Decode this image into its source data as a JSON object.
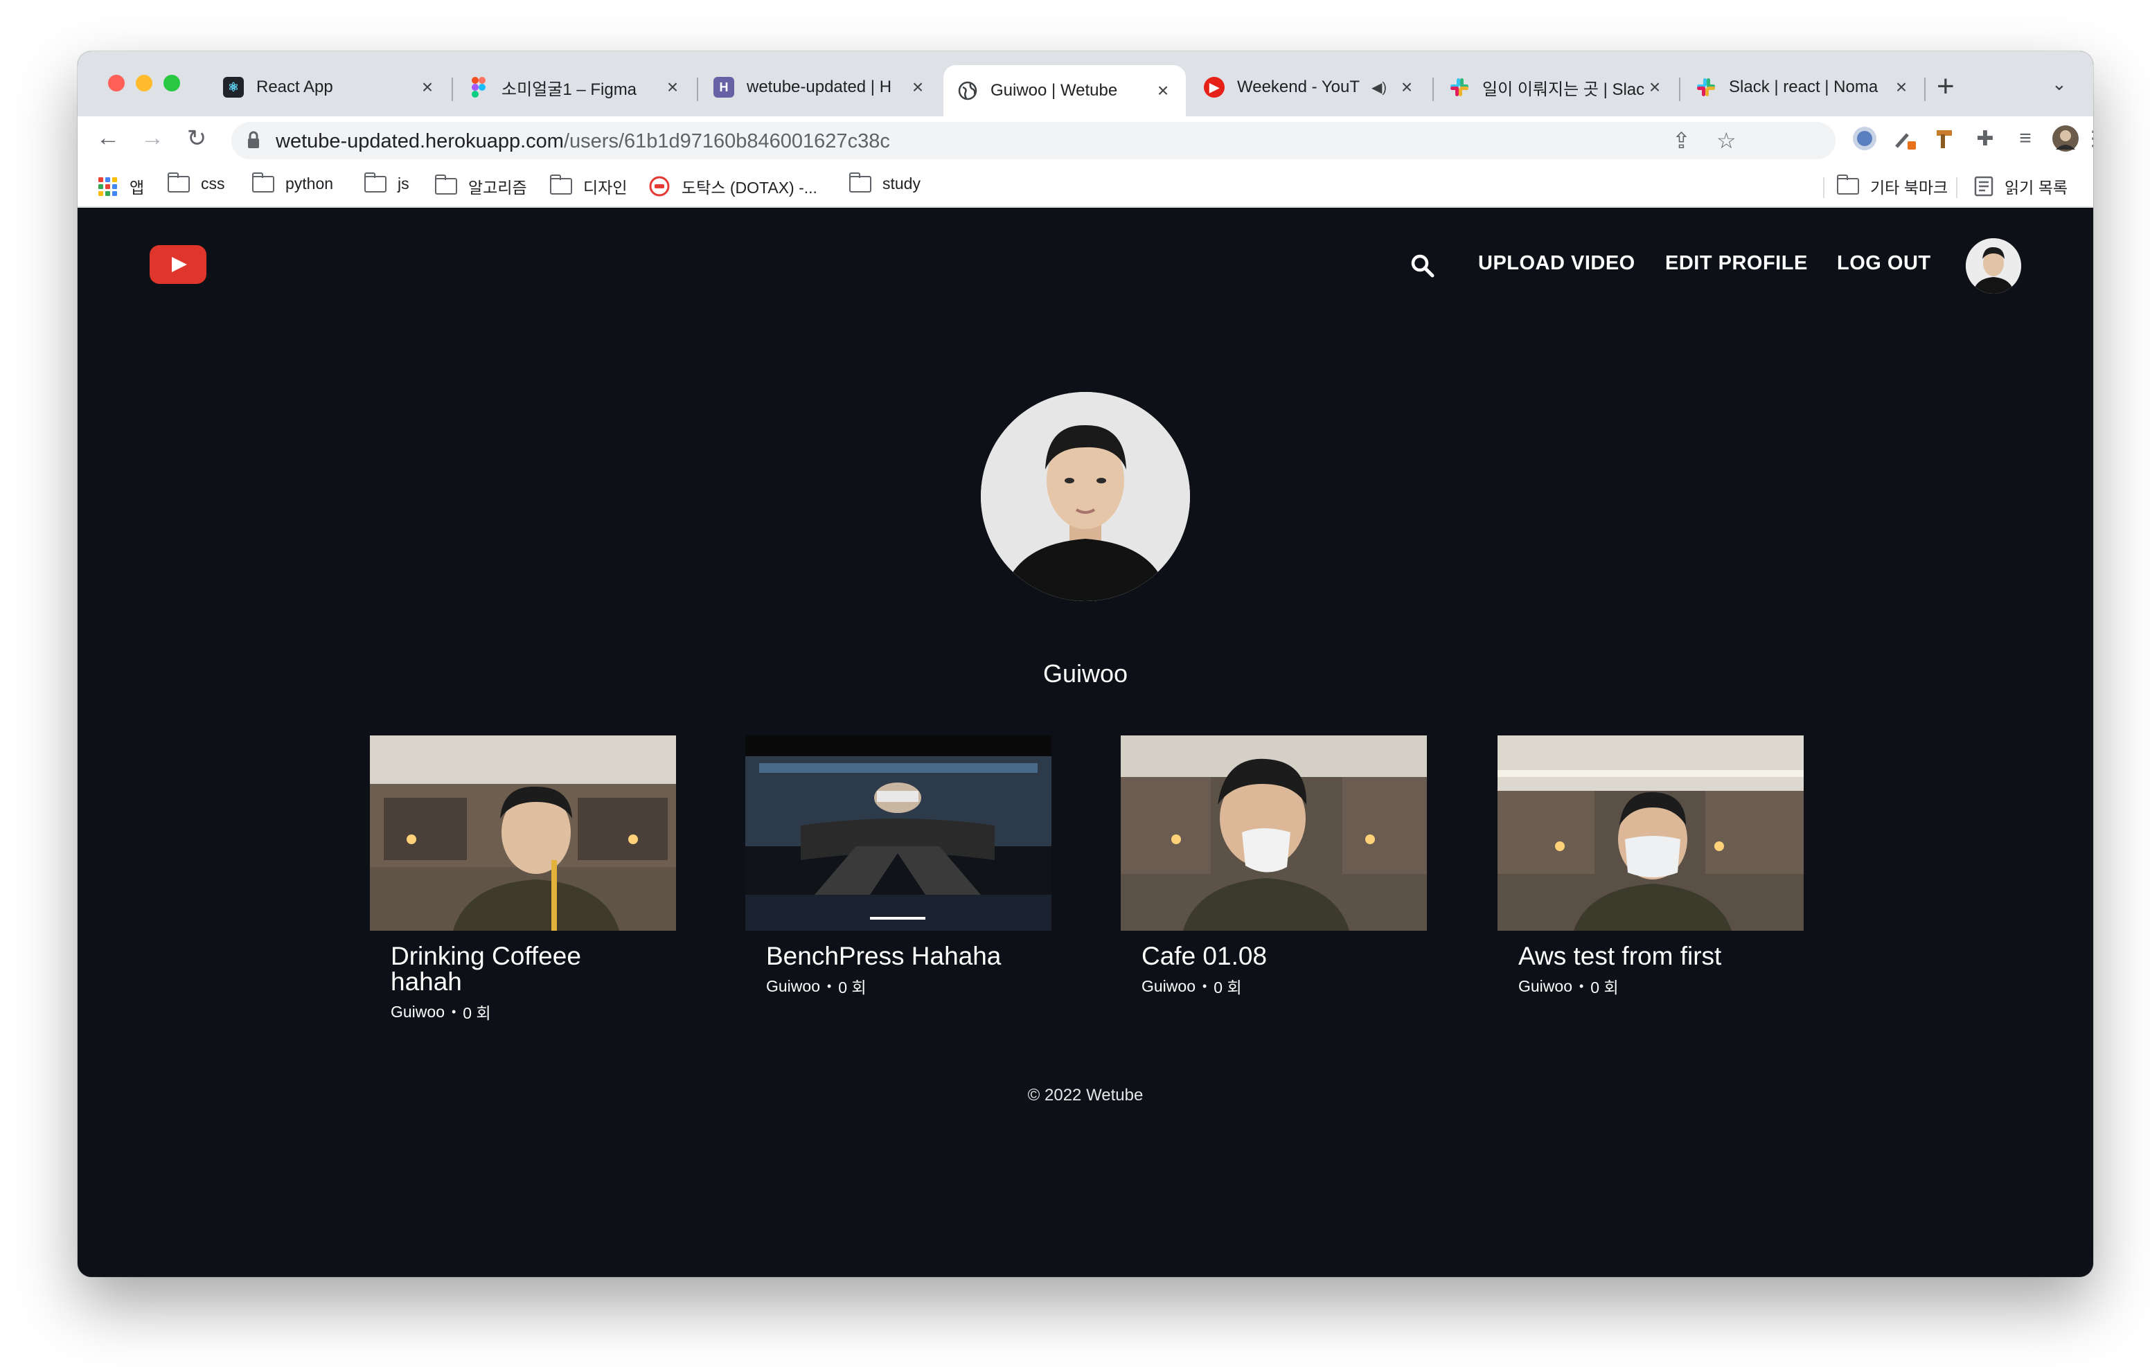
{
  "browser": {
    "tabs": [
      {
        "title": "React App",
        "active": false
      },
      {
        "title": "소미얼굴1 – Figma",
        "active": false
      },
      {
        "title": "wetube-updated | H",
        "active": false
      },
      {
        "title": "Guiwoo | Wetube",
        "active": true
      },
      {
        "title": "Weekend - YouT",
        "active": false,
        "audio": true
      },
      {
        "title": "일이 이뤄지는 곳 | Slac",
        "active": false
      },
      {
        "title": "Slack | react | Noma",
        "active": false
      }
    ],
    "address": {
      "host": "wetube-updated.herokuapp.com",
      "path": "/users/61b1d97160b846001627c38c"
    },
    "bookmarks": [
      {
        "label": "앱",
        "type": "apps"
      },
      {
        "label": "css",
        "type": "folder"
      },
      {
        "label": "python",
        "type": "folder"
      },
      {
        "label": "js",
        "type": "folder"
      },
      {
        "label": "알고리즘",
        "type": "folder"
      },
      {
        "label": "디자인",
        "type": "folder"
      },
      {
        "label": "도탁스 (DOTAX) -...",
        "type": "site"
      },
      {
        "label": "study",
        "type": "folder"
      }
    ],
    "other_bookmarks": "기타 북마크",
    "reading_list": "읽기 목록"
  },
  "site": {
    "nav": {
      "upload": "UPLOAD VIDEO",
      "edit_profile": "EDIT PROFILE",
      "logout": "LOG OUT"
    },
    "profile": {
      "name": "Guiwoo"
    },
    "videos": [
      {
        "title": "Drinking Coffeee hahah",
        "owner": "Guiwoo",
        "views": "0 회"
      },
      {
        "title": "BenchPress Hahaha",
        "owner": "Guiwoo",
        "views": "0 회"
      },
      {
        "title": "Cafe 01.08",
        "owner": "Guiwoo",
        "views": "0 회"
      },
      {
        "title": "Aws test from first",
        "owner": "Guiwoo",
        "views": "0 회"
      }
    ],
    "footer": "© 2022 Wetube"
  },
  "colors": {
    "page_bg": "#0d1016",
    "brand_red": "#e0352b",
    "tab_strip": "#dee1e6"
  }
}
